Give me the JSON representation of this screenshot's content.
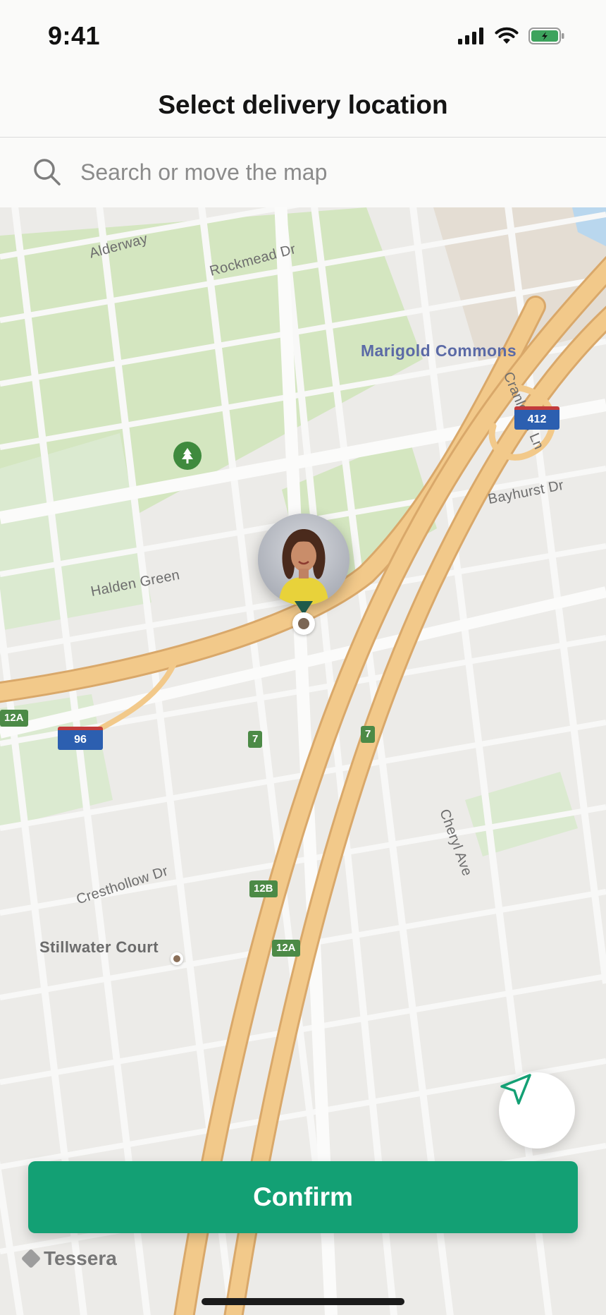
{
  "status_bar": {
    "time": "9:41"
  },
  "header": {
    "title": "Select delivery location"
  },
  "search": {
    "value": "",
    "placeholder": "Search or move the map"
  },
  "map": {
    "street_labels": {
      "alderway": "Alderway",
      "rockmead": "Rockmead Dr",
      "cranleigh": "Cranleigh Ln",
      "bayhurst": "Bayhurst Dr",
      "halden": "Halden Green",
      "cresthollow": "Cresthollow Dr",
      "cheryl": "Cheryl Ave"
    },
    "poi": {
      "marigold": "Marigold Commons"
    },
    "place": {
      "stillwater": "Stillwater Court"
    },
    "shields": {
      "route_412": "412",
      "route_96": "96"
    },
    "exits": {
      "exit_12a_left": "12A",
      "exit_7_a": "7",
      "exit_7_b": "7",
      "exit_12b": "12B",
      "exit_12a": "12A"
    }
  },
  "actions": {
    "confirm_label": "Confirm"
  },
  "branding": {
    "name": "Tessera"
  },
  "colors": {
    "accent": "#13a074",
    "highway": "#f2c98a",
    "park": "#d4e6c0",
    "water": "#b9d7ee"
  }
}
